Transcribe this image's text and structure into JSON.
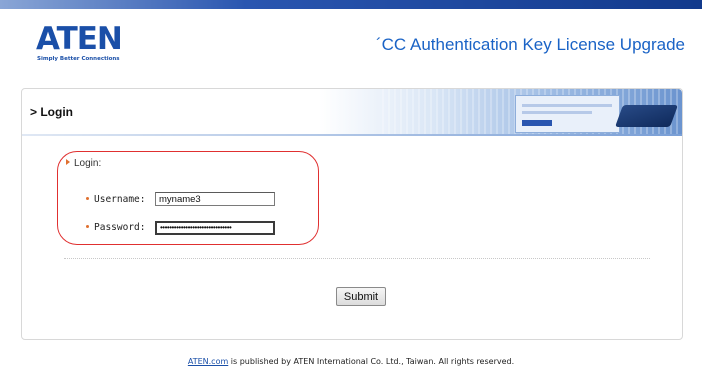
{
  "brand": {
    "logo_text": "ATEN",
    "tagline": "Simply Better Connections",
    "accent_color": "#1a4fa8",
    "title_color": "#1a63c6"
  },
  "header": {
    "title": "´CC Authentication Key License Upgrade"
  },
  "panel": {
    "section_title": "> Login"
  },
  "login": {
    "heading": "Login:",
    "username_label": "Username:",
    "username_value": "myname3",
    "password_label": "Password:",
    "password_value": "•••••••••••••••••••••••••••••••",
    "highlight_color": "#e03030"
  },
  "actions": {
    "submit_label": "Submit"
  },
  "footer": {
    "link_text": "ATEN.com",
    "text": " is published by ATEN International Co. Ltd., Taiwan. All rights reserved."
  }
}
